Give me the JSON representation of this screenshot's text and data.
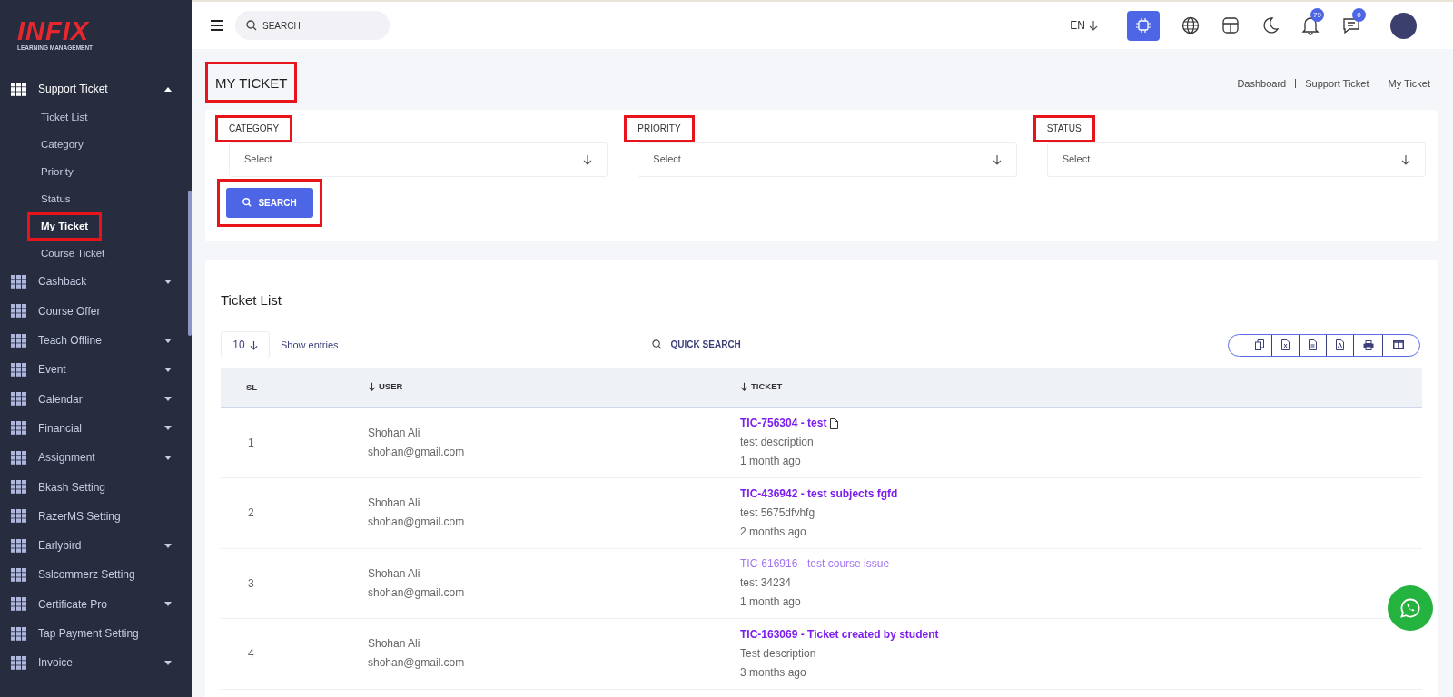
{
  "sidebar": {
    "logo": {
      "brand": "INFIX",
      "tagline": "LEARNING MANAGEMENT"
    },
    "items": [
      {
        "label": "Support Ticket",
        "expanded": true,
        "has_caret": true,
        "children": [
          {
            "label": "Ticket List",
            "selected": false,
            "highlighted": false
          },
          {
            "label": "Category",
            "selected": false,
            "highlighted": false
          },
          {
            "label": "Priority",
            "selected": false,
            "highlighted": false
          },
          {
            "label": "Status",
            "selected": false,
            "highlighted": false
          },
          {
            "label": "My Ticket",
            "selected": true,
            "highlighted": true
          },
          {
            "label": "Course Ticket",
            "selected": false,
            "highlighted": false
          }
        ]
      },
      {
        "label": "Cashback",
        "expanded": false,
        "has_caret": true
      },
      {
        "label": "Course Offer",
        "expanded": false,
        "has_caret": false
      },
      {
        "label": "Teach Offline",
        "expanded": false,
        "has_caret": true
      },
      {
        "label": "Event",
        "expanded": false,
        "has_caret": true
      },
      {
        "label": "Calendar",
        "expanded": false,
        "has_caret": true
      },
      {
        "label": "Financial",
        "expanded": false,
        "has_caret": true
      },
      {
        "label": "Assignment",
        "expanded": false,
        "has_caret": true
      },
      {
        "label": "Bkash Setting",
        "expanded": false,
        "has_caret": false
      },
      {
        "label": "RazerMS Setting",
        "expanded": false,
        "has_caret": false
      },
      {
        "label": "Earlybird",
        "expanded": false,
        "has_caret": true
      },
      {
        "label": "Sslcommerz Setting",
        "expanded": false,
        "has_caret": false
      },
      {
        "label": "Certificate Pro",
        "expanded": false,
        "has_caret": true
      },
      {
        "label": "Tap Payment Setting",
        "expanded": false,
        "has_caret": false
      },
      {
        "label": "Invoice",
        "expanded": false,
        "has_caret": true
      }
    ]
  },
  "topbar": {
    "search": {
      "placeholder": "SEARCH"
    },
    "language": "EN",
    "notifications": "79",
    "messages": "0"
  },
  "page": {
    "title": "MY TICKET",
    "title_highlighted": true,
    "breadcrumb": [
      "Dashboard",
      "Support Ticket",
      "My Ticket"
    ]
  },
  "filters": {
    "fields": [
      {
        "label": "CATEGORY",
        "value": "Select",
        "highlighted": true
      },
      {
        "label": "PRIORITY",
        "value": "Select",
        "highlighted": true
      },
      {
        "label": "STATUS",
        "value": "Select",
        "highlighted": true
      }
    ],
    "search_button": {
      "label": "SEARCH",
      "highlighted": true
    }
  },
  "ticket_list": {
    "title": "Ticket List",
    "page_size": "10",
    "show_entries": "Show entries",
    "quick_search": {
      "placeholder": "QUICK SEARCH"
    },
    "columns": [
      "SL",
      "USER",
      "TICKET"
    ],
    "rows": [
      {
        "sl": "1",
        "user_name": "Shohan Ali",
        "user_email": "shohan@gmail.com",
        "ticket": "TIC-756304 - test",
        "attachment": true,
        "visited": false,
        "description": "test description",
        "age": "1 month ago"
      },
      {
        "sl": "2",
        "user_name": "Shohan Ali",
        "user_email": "shohan@gmail.com",
        "ticket": "TIC-436942 - test subjects fgfd",
        "attachment": false,
        "visited": false,
        "description": "test 5675dfvhfg",
        "age": "2 months ago"
      },
      {
        "sl": "3",
        "user_name": "Shohan Ali",
        "user_email": "shohan@gmail.com",
        "ticket": "TIC-616916 - test course issue",
        "attachment": false,
        "visited": true,
        "description": "test 34234",
        "age": "1 month ago"
      },
      {
        "sl": "4",
        "user_name": "Shohan Ali",
        "user_email": "shohan@gmail.com",
        "ticket": "TIC-163069 - Ticket created by student",
        "attachment": false,
        "visited": false,
        "description": "Test description",
        "age": "3 months ago"
      }
    ]
  }
}
